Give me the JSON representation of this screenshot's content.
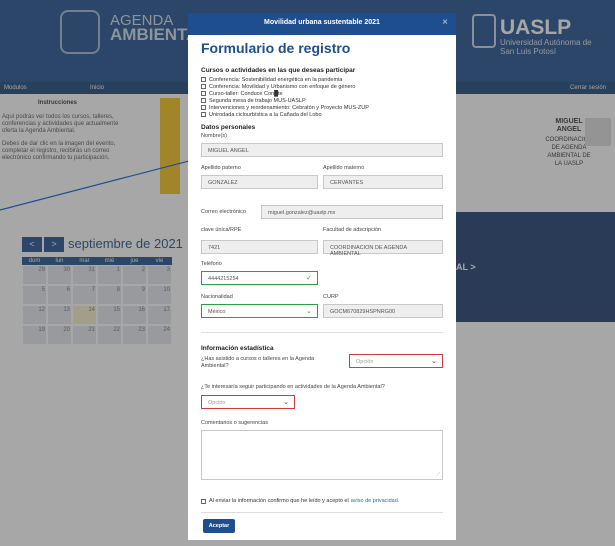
{
  "background": {
    "brand_line1": "AGENDA",
    "brand_line2": "AMBIENTAL",
    "uaslp": "UASLP",
    "uaslp_sub": "Universidad Autónoma de San Luis Potosí",
    "nav": {
      "modulos": "Modulos",
      "inicio": "Inicio",
      "logout": "Cerrar sesión"
    },
    "instructions_title": "Instrucciones",
    "instructions_p1": "Aquí podrás ver todos los cursos, talleres, conferencias y actividades que actualmente oferta la Agenda Ambiental.",
    "instructions_p2": "Debes de dar clic en la imagen del evento, completar el registro, recibirás un correo electrónico confirmando tu participación.",
    "user_name": "MIGUEL ANGEL",
    "user_role": "COORDINACION DE AGENDA AMBIENTAL DE LA UASLP",
    "calendar": {
      "prev": "<",
      "next": ">",
      "month": "septiembre de 2021",
      "days": [
        "dom",
        "lun",
        "mar",
        "mié",
        "jue",
        "vie"
      ],
      "cells": [
        "29",
        "30",
        "31",
        "1",
        "2",
        "3",
        "5",
        "6",
        "7",
        "8",
        "9",
        "10",
        "12",
        "13",
        "14",
        "15",
        "16",
        "17",
        "19",
        "20",
        "21",
        "22",
        "23",
        "24"
      ]
    },
    "dark_panel_text": "AL >"
  },
  "modal": {
    "title": "Movilidad urbana sustentable 2021",
    "close": "×",
    "form_title": "Formulario de registro",
    "courses_title": "Cursos o actividades en las que deseas participar",
    "courses": [
      "Conferencia: Sostenibilidad energética en la pandemia",
      "Conferencia: Movilidad y Urbanismo con enfoque de género",
      "Curso-taller: Conduce Con█te",
      "Segunda mesa de trabajo MUS-UASLP",
      "Intervenciones y reordenamiento: Cebratón y Proyecto MUS-ZUP",
      "Unirodada ciclourbística a la Cañada del Lobo"
    ],
    "personal_title": "Datos personales",
    "name_label": "Nombre(s)",
    "name_value": "MIGUEL ANGEL",
    "paternal_label": "Apellido paterno",
    "paternal_value": "GONZALEZ",
    "maternal_label": "Apellido materno",
    "maternal_value": "CERVANTES",
    "email_label": "Correo electrónico",
    "email_value": "miguel.gonzalez@uaslp.mx",
    "id_label": "clave única/RPE",
    "id_value": "7421",
    "faculty_label": "Facultad de adscripción",
    "faculty_value": "COORDINACION DE AGENDA AMBIENTAL",
    "phone_label": "Teléfono",
    "phone_value": "4444215254",
    "nationality_label": "Nacionalidad",
    "nationality_value": "México",
    "curp_label": "CURP",
    "curp_value": "GOCM670829HSPNRG00",
    "stats_title": "Información estadística",
    "q1": "¿Has asistido a cursos o talleres en la Agenda Ambiental?",
    "q1_placeholder": "Opción",
    "q2": "¿Te interesaría seguir participando en actividades de la Agenda Ambiental?",
    "q2_placeholder": "Opción",
    "comments_label": "Comentarios o sugerencias",
    "privacy_text": "Al enviar la información confirmo que he leído y acepto el",
    "privacy_link": "aviso de privacidad.",
    "accept": "Aceptar"
  },
  "colors": {
    "primary": "#1f4e8f",
    "valid": "#2ea043",
    "error": "#d23c3c",
    "accent_yellow": "#f2c31b"
  }
}
